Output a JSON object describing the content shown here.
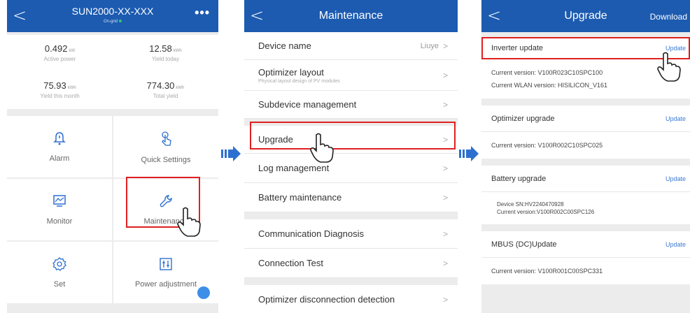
{
  "panel1": {
    "title": "SUN2000-XX-XXX",
    "status": "On-grid",
    "more": "•••",
    "stats": [
      {
        "value": "0.492",
        "unit": "kW",
        "label": "Active power"
      },
      {
        "value": "12.58",
        "unit": "kWh",
        "label": "Yield today"
      },
      {
        "value": "75.93",
        "unit": "kWh",
        "label": "Yield this month"
      },
      {
        "value": "774.30",
        "unit": "kWh",
        "label": "Total yield"
      }
    ],
    "tiles": [
      {
        "label": "Alarm",
        "icon": "bell-icon"
      },
      {
        "label": "Quick Settings",
        "icon": "touch-icon"
      },
      {
        "label": "Monitor",
        "icon": "monitor-icon"
      },
      {
        "label": "Maintenance",
        "icon": "wrench-icon"
      },
      {
        "label": "Set",
        "icon": "gear-icon"
      },
      {
        "label": "Power adjustment",
        "icon": "sliders-icon"
      }
    ]
  },
  "panel2": {
    "title": "Maintenance",
    "device_name": {
      "label": "Device name",
      "value": "Liuye"
    },
    "optimizer_layout": {
      "label": "Optimizer layout",
      "sub": "Physical layout design of PV modules"
    },
    "subdevice": "Subdevice management",
    "upgrade": "Upgrade",
    "log": "Log management",
    "battery": "Battery maintenance",
    "comm": "Communication Diagnosis",
    "conn": "Connection Test",
    "optdisc": "Optimizer disconnection detection"
  },
  "panel3": {
    "title": "Upgrade",
    "download": "Download",
    "inverter": {
      "label": "Inverter update",
      "action": "Update",
      "line1": "Current version: V100R023C10SPC100",
      "line2": "Current WLAN version: HISILICON_V161"
    },
    "optimizer": {
      "label": "Optimizer upgrade",
      "action": "Update",
      "line1": "Current version: V100R002C10SPC025"
    },
    "battery": {
      "label": "Battery upgrade",
      "action": "Update",
      "line1": "Device SN:HV2240470928",
      "line2": "Current version:V100R002C00SPC126"
    },
    "mbus": {
      "label": "MBUS (DC)Update",
      "action": "Update",
      "line1": "Current version: V100R001C00SPC331"
    }
  },
  "colors": {
    "header": "#1c5bb0",
    "highlight": "#e02020",
    "link": "#3a7bd5",
    "arrow": "#2d6fcf"
  }
}
